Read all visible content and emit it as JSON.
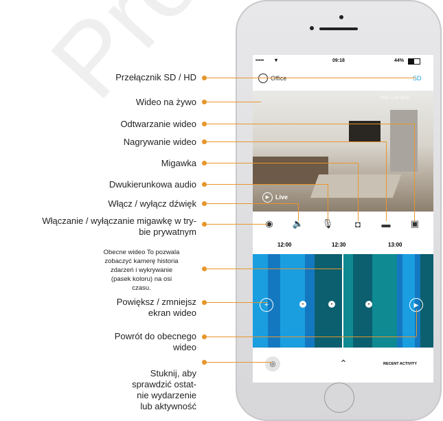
{
  "watermark": "Pronik",
  "annotations": {
    "sd_hd": "Przełącznik SD / HD",
    "live_video": "Wideo na żywo",
    "playback": "Odtwarzanie wideo",
    "recording": "Nagrywanie wideo",
    "snapshot": "Migawka",
    "two_way_audio": "Dwukierunkowa audio",
    "sound_toggle": "Włącz / wyłącz dźwięk",
    "privacy_line1": "Włączanie / wyłączanie migawkę w try-",
    "privacy_line2": "bie prywatnym",
    "current_video_l1": "Obecne wideo To pozwala",
    "current_video_l2": "zobaczyć kamerę historia",
    "current_video_l3": "zdarzeń i wykrywanie",
    "current_video_l4": "(pasek koloru) na osi",
    "current_video_l5": "czasu.",
    "zoom_l1": "Powiększ / zmniejsz",
    "zoom_l2": "ekran wideo",
    "back_l1": "Powrót do obecnego",
    "back_l2": "wideo",
    "tap_l1": "Stuknij, aby",
    "tap_l2": "sprawdzić ostat-",
    "tap_l3": "nie wydarzenie",
    "tap_l4": "lub aktywność"
  },
  "phone": {
    "status": {
      "signal": "•••••",
      "time": "09:18",
      "battery": "44%"
    },
    "camera_name": "Office",
    "quality": "SD",
    "video_timestamp": "2017.1.20 15:57",
    "live_badge": "Live",
    "timeline_ticks": [
      "12:00",
      "12:30",
      "13:00"
    ],
    "recent_activity": "RECENT ACTIVITY"
  },
  "colors": {
    "accent": "#e8952a",
    "cyan": "#1a9ee0",
    "dark_teal": "#0b5f6e",
    "teal": "#0f8a93",
    "blue": "#1478c0"
  }
}
